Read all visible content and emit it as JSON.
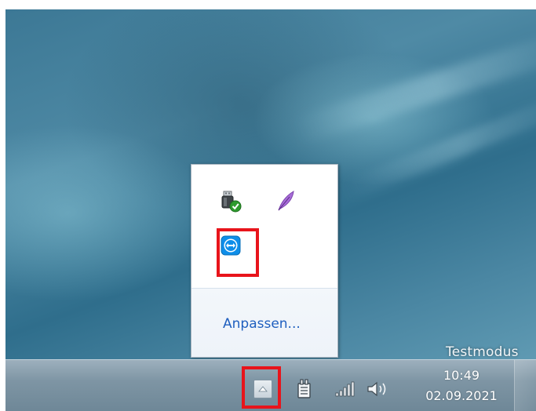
{
  "desktop": {
    "watermark_text": "Testmodus"
  },
  "notification_overflow": {
    "icons": [
      {
        "name": "usb-safely-remove-icon"
      },
      {
        "name": "feather-app-icon"
      },
      {
        "name": "teamviewer-icon"
      }
    ],
    "customize_label": "Anpassen..."
  },
  "taskbar": {
    "tray_icons": [
      "show-hidden-icons-button",
      "power-icon",
      "network-signal-icon",
      "volume-icon"
    ],
    "clock": {
      "time": "10:49",
      "date": "02.09.2021"
    }
  },
  "colors": {
    "highlight": "#e8141b",
    "link": "#1f5fbf",
    "teamviewer_blue": "#0e8ee9"
  }
}
